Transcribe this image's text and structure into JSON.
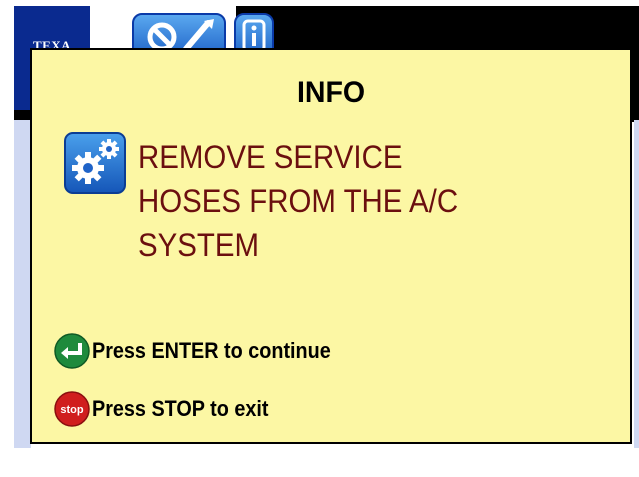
{
  "header": {
    "logo_text": "TEXA",
    "buttons": [
      {
        "name": "tools-button",
        "icon": "tools-icon"
      },
      {
        "name": "info-button",
        "icon": "info-icon"
      }
    ]
  },
  "dialog": {
    "title": "INFO",
    "icon": "gears-icon",
    "message_lines": [
      "REMOVE SERVICE",
      "HOSES FROM THE A/C",
      "SYSTEM"
    ],
    "message_color": "#6b0f0f",
    "background": "#fcf7a4",
    "actions": {
      "enter": {
        "label": "Press ENTER to continue",
        "icon": "enter-icon",
        "color": "#1e8a3c"
      },
      "stop": {
        "label": "Press STOP to exit",
        "icon": "stop-icon",
        "icon_text": "stop",
        "color": "#d01e1e"
      }
    }
  },
  "colors": {
    "brand_blue": "#0a2a8f",
    "button_blue": "#1f63c8"
  }
}
